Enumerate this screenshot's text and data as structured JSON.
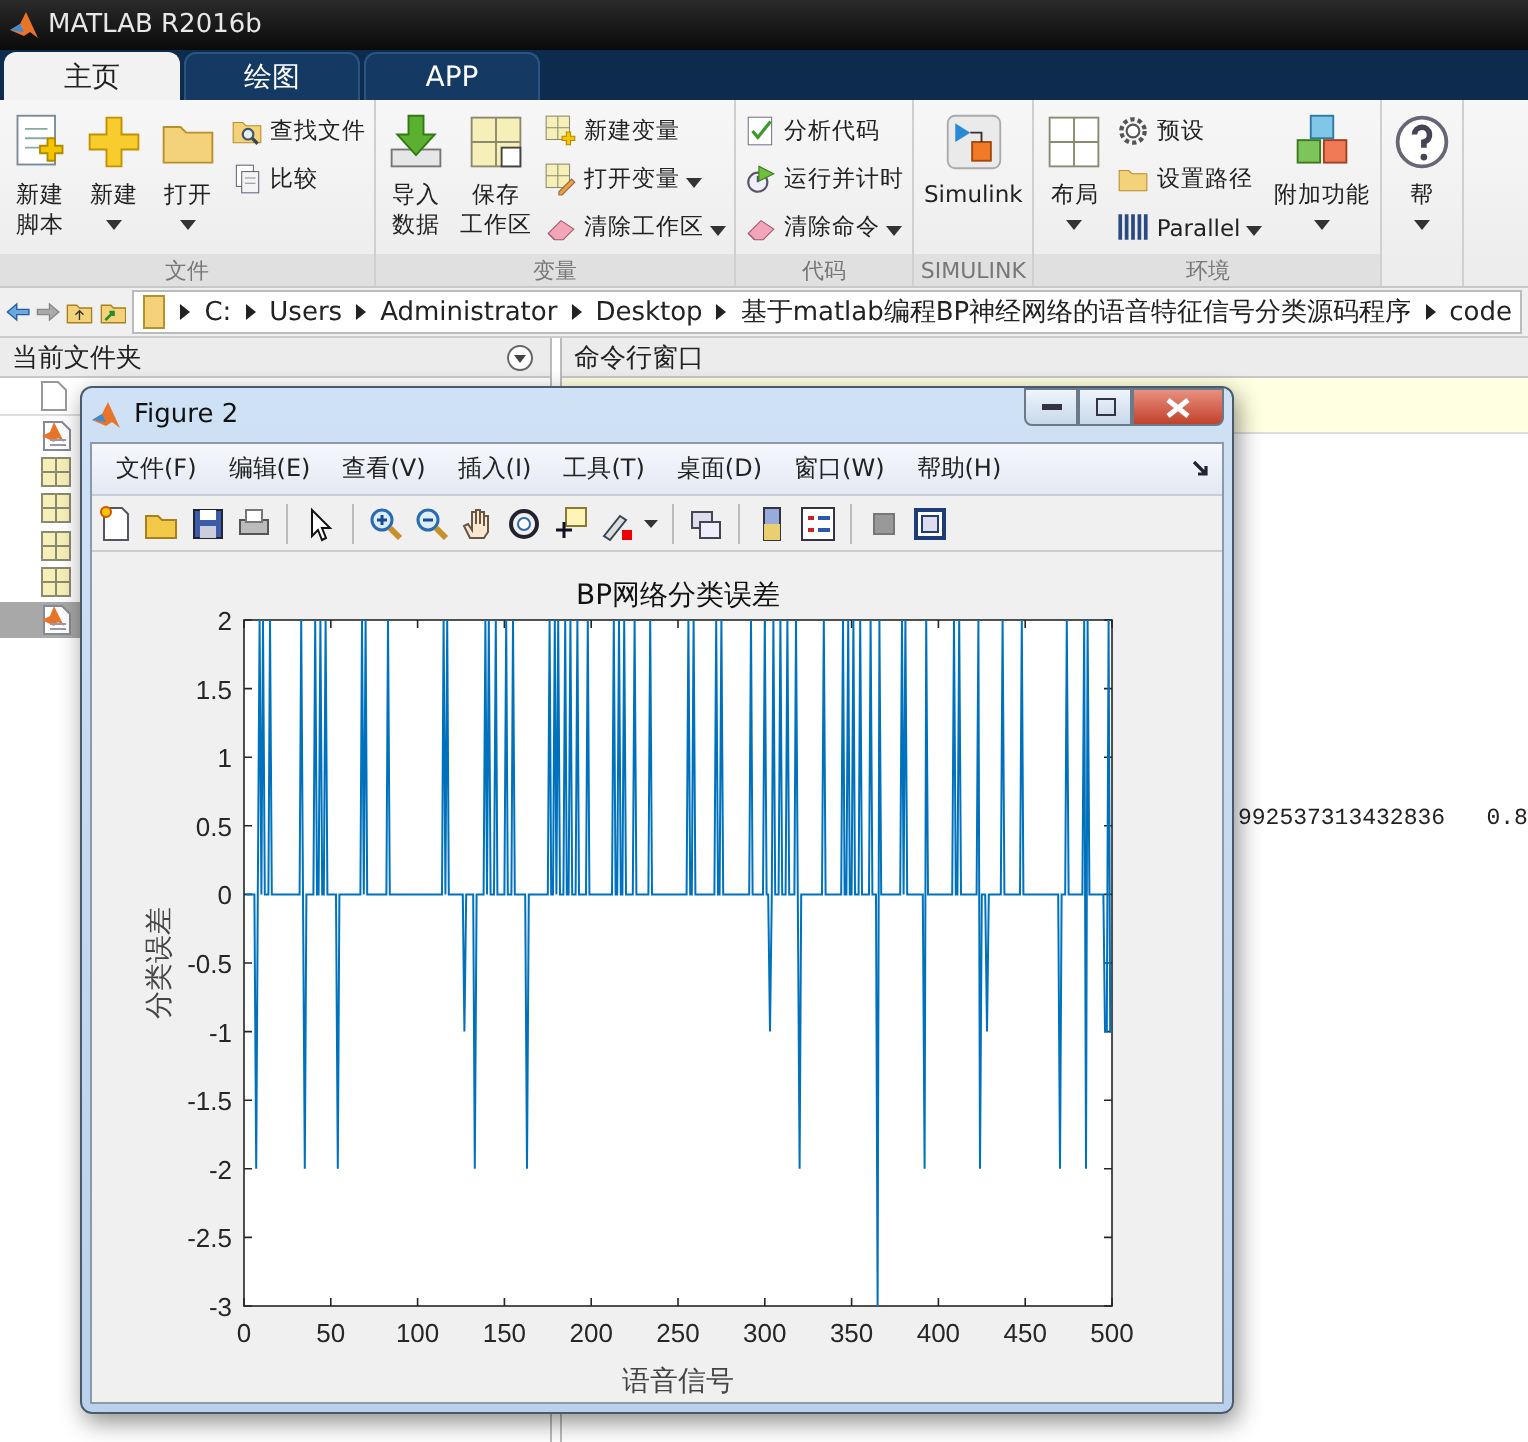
{
  "window": {
    "title": "MATLAB R2016b"
  },
  "ribbon": {
    "tabs": [
      {
        "label": "主页",
        "selected": true
      },
      {
        "label": "绘图",
        "selected": false
      },
      {
        "label": "APP",
        "selected": false
      }
    ],
    "groups": [
      {
        "label": "文件",
        "items": [
          {
            "kind": "large",
            "lines": [
              "新建",
              "脚本"
            ],
            "dropdown": false
          },
          {
            "kind": "large",
            "lines": [
              "新建"
            ],
            "dropdown": true
          },
          {
            "kind": "large",
            "lines": [
              "打开"
            ],
            "dropdown": true
          },
          {
            "kind": "stack",
            "buttons": [
              {
                "label": "查找文件",
                "dropdown": false
              },
              {
                "label": "比较",
                "dropdown": false
              }
            ]
          }
        ]
      },
      {
        "label": "变量",
        "items": [
          {
            "kind": "large",
            "lines": [
              "导入",
              "数据"
            ],
            "dropdown": false
          },
          {
            "kind": "large",
            "lines": [
              "保存",
              "工作区"
            ],
            "dropdown": false
          },
          {
            "kind": "stack",
            "buttons": [
              {
                "label": "新建变量",
                "dropdown": false
              },
              {
                "label": "打开变量",
                "dropdown": true
              },
              {
                "label": "清除工作区",
                "dropdown": true
              }
            ]
          }
        ]
      },
      {
        "label": "代码",
        "items": [
          {
            "kind": "stack",
            "buttons": [
              {
                "label": "分析代码",
                "dropdown": false
              },
              {
                "label": "运行并计时",
                "dropdown": false
              },
              {
                "label": "清除命令",
                "dropdown": true
              }
            ]
          }
        ]
      },
      {
        "label": "SIMULINK",
        "items": [
          {
            "kind": "large",
            "lines": [
              "Simulink"
            ],
            "dropdown": false
          }
        ]
      },
      {
        "label": "环境",
        "items": [
          {
            "kind": "large",
            "lines": [
              "布局"
            ],
            "dropdown": true
          },
          {
            "kind": "stack",
            "buttons": [
              {
                "label": "预设",
                "dropdown": false
              },
              {
                "label": "设置路径",
                "dropdown": false
              },
              {
                "label": "Parallel",
                "dropdown": true
              }
            ]
          },
          {
            "kind": "large",
            "lines": [
              "附加功能"
            ],
            "dropdown": true
          }
        ]
      },
      {
        "items": [
          {
            "kind": "large",
            "lines": [
              "帮"
            ],
            "dropdown": true
          }
        ]
      }
    ]
  },
  "address_bar": {
    "path": [
      "C:",
      "Users",
      "Administrator",
      "Desktop",
      "基于matlab编程BP神经网络的语音特征信号分类源码程序",
      "code"
    ]
  },
  "current_folder": {
    "title": "当前文件夹",
    "files": [
      {
        "kind": "mfile",
        "selected": false
      },
      {
        "kind": "mat",
        "selected": false
      },
      {
        "kind": "mat",
        "selected": false
      },
      {
        "kind": "mat",
        "selected": false
      },
      {
        "kind": "mat",
        "selected": false
      },
      {
        "kind": "mfile",
        "selected": true
      }
    ]
  },
  "command_window": {
    "title": "命令行窗口",
    "output": "992537313432836   0.8"
  },
  "figure": {
    "title": "Figure 2",
    "menus": [
      "文件(F)",
      "编辑(E)",
      "查看(V)",
      "插入(I)",
      "工具(T)",
      "桌面(D)",
      "窗口(W)",
      "帮助(H)"
    ],
    "axes": {
      "chart_data": {
        "type": "line",
        "title": "BP网络分类误差",
        "xlabel": "语音信号",
        "ylabel": "分类误差",
        "xlim": [
          0,
          500
        ],
        "ylim": [
          -3,
          2
        ],
        "xticks": [
          0,
          50,
          100,
          150,
          200,
          250,
          300,
          350,
          400,
          450,
          500
        ],
        "yticks": [
          -3,
          -2.5,
          -2,
          -1.5,
          -1,
          -0.5,
          0,
          0.5,
          1,
          1.5,
          2
        ],
        "x": [
          1,
          6,
          7,
          8,
          9,
          10,
          11,
          12,
          14,
          15,
          16,
          32,
          33,
          34,
          35,
          36,
          40,
          41,
          42,
          43,
          44,
          45,
          46,
          47,
          48,
          53,
          54,
          55,
          67,
          68,
          69,
          70,
          71,
          82,
          83,
          84,
          114,
          115,
          116,
          117,
          118,
          126,
          127,
          128,
          132,
          133,
          134,
          138,
          139,
          140,
          141,
          142,
          144,
          145,
          146,
          150,
          151,
          152,
          154,
          155,
          156,
          162,
          163,
          164,
          175,
          176,
          177,
          178,
          179,
          180,
          181,
          182,
          184,
          185,
          186,
          187,
          188,
          189,
          191,
          192,
          193,
          197,
          198,
          199,
          212,
          213,
          214,
          215,
          216,
          217,
          218,
          219,
          220,
          224,
          225,
          226,
          233,
          234,
          235,
          255,
          256,
          257,
          258,
          259,
          260,
          271,
          272,
          273,
          274,
          275,
          276,
          291,
          292,
          293,
          299,
          300,
          301,
          302,
          303,
          304,
          305,
          306,
          308,
          309,
          310,
          312,
          313,
          314,
          317,
          318,
          319,
          320,
          321,
          333,
          334,
          335,
          344,
          345,
          346,
          347,
          348,
          349,
          350,
          351,
          352,
          354,
          355,
          356,
          360,
          361,
          362,
          364,
          365,
          366,
          367,
          378,
          379,
          380,
          381,
          382,
          391,
          392,
          393,
          394,
          408,
          409,
          410,
          411,
          412,
          413,
          422,
          423,
          424,
          425,
          427,
          428,
          429,
          436,
          437,
          438,
          447,
          448,
          449,
          469,
          470,
          471,
          473,
          474,
          475,
          483,
          484,
          485,
          486,
          487,
          495,
          496,
          497,
          498,
          499,
          500
        ],
        "series": [
          {
            "color": "#0072bd",
            "values": [
              0,
              0,
              -2,
              0,
              2,
              0,
              2,
              0,
              0,
              2,
              0,
              0,
              2,
              0,
              -2,
              0,
              0,
              2,
              0,
              0,
              2,
              0,
              0,
              2,
              0,
              0,
              -2,
              0,
              0,
              2,
              0,
              2,
              0,
              0,
              2,
              0,
              0,
              2,
              0,
              2,
              0,
              0,
              -1,
              0,
              0,
              -2,
              0,
              0,
              2,
              0,
              2,
              0,
              0,
              2,
              0,
              0,
              2,
              0,
              0,
              2,
              0,
              0,
              -2,
              0,
              0,
              2,
              0,
              0,
              2,
              0,
              2,
              0,
              0,
              2,
              0,
              0,
              2,
              0,
              0,
              2,
              0,
              0,
              2,
              0,
              0,
              2,
              0,
              0,
              2,
              0,
              0,
              2,
              0,
              0,
              2,
              0,
              0,
              2,
              0,
              0,
              2,
              0,
              0,
              2,
              0,
              0,
              2,
              0,
              0,
              2,
              0,
              0,
              2,
              0,
              0,
              2,
              0,
              0,
              -1,
              0,
              2,
              0,
              0,
              2,
              0,
              0,
              2,
              0,
              0,
              2,
              0,
              -2,
              0,
              0,
              2,
              0,
              0,
              2,
              0,
              0,
              2,
              0,
              0,
              2,
              0,
              0,
              2,
              0,
              0,
              2,
              0,
              0,
              -3,
              2,
              0,
              0,
              2,
              0,
              2,
              0,
              0,
              -2,
              2,
              0,
              0,
              2,
              0,
              0,
              2,
              0,
              0,
              2,
              -2,
              0,
              0,
              -1,
              0,
              0,
              2,
              0,
              0,
              2,
              0,
              0,
              -2,
              0,
              0,
              2,
              0,
              0,
              2,
              -2,
              2,
              0,
              0,
              -1,
              -1,
              2,
              -1,
              -1
            ]
          }
        ]
      }
    }
  }
}
